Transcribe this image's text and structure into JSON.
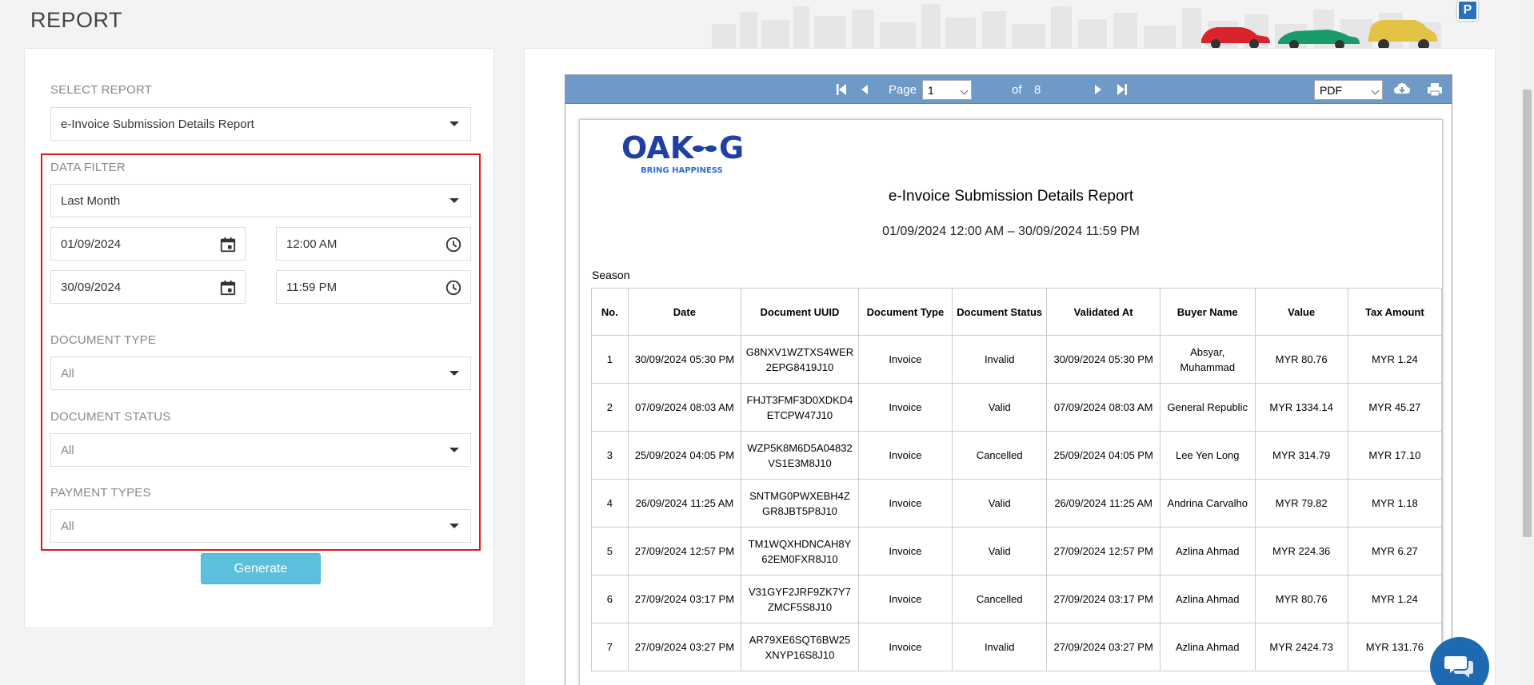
{
  "page": {
    "title": "REPORT"
  },
  "left": {
    "select_report_label": "SELECT REPORT",
    "select_report_value": "e-Invoice Submission Details Report",
    "data_filter_label": "DATA FILTER",
    "data_filter_value": "Last Month",
    "start_date": "01/09/2024",
    "start_time": "12:00 AM",
    "end_date": "30/09/2024",
    "end_time": "11:59 PM",
    "document_type_label": "DOCUMENT TYPE",
    "document_type_value": "All",
    "document_status_label": "DOCUMENT STATUS",
    "document_status_value": "All",
    "payment_types_label": "PAYMENT TYPES",
    "payment_types_value": "All",
    "generate_label": "Generate"
  },
  "viewer": {
    "page_label": "Page",
    "page_value": "1",
    "of_label": "of",
    "total_pages": "8",
    "format_value": "PDF"
  },
  "report": {
    "logo_text": "OAK G",
    "logo_tagline": "BRING HAPPINESS",
    "title": "e-Invoice Submission Details Report",
    "range": "01/09/2024 12:00 AM – 30/09/2024 11:59 PM",
    "section": "Season",
    "headers": [
      "No.",
      "Date",
      "Document UUID",
      "Document Type",
      "Document Status",
      "Validated At",
      "Buyer Name",
      "Value",
      "Tax Amount"
    ],
    "rows": [
      {
        "no": "1",
        "date": "30/09/2024 05:30 PM",
        "uuid1": "G8NXV1WZTXS4WER",
        "uuid2": "2EPG8419J10",
        "type": "Invoice",
        "status": "Invalid",
        "validated": "30/09/2024 05:30 PM",
        "buyer1": "Absyar,",
        "buyer2": "Muhammad",
        "value": "MYR 80.76",
        "tax": "MYR 1.24"
      },
      {
        "no": "2",
        "date": "07/09/2024 08:03 AM",
        "uuid1": "FHJT3FMF3D0XDKD4",
        "uuid2": "ETCPW47J10",
        "type": "Invoice",
        "status": "Valid",
        "validated": "07/09/2024 08:03 AM",
        "buyer1": "General Republic",
        "buyer2": "",
        "value": "MYR 1334.14",
        "tax": "MYR 45.27"
      },
      {
        "no": "3",
        "date": "25/09/2024 04:05 PM",
        "uuid1": "WZP5K8M6D5A04832",
        "uuid2": "VS1E3M8J10",
        "type": "Invoice",
        "status": "Cancelled",
        "validated": "25/09/2024 04:05 PM",
        "buyer1": "Lee Yen Long",
        "buyer2": "",
        "value": "MYR 314.79",
        "tax": "MYR 17.10"
      },
      {
        "no": "4",
        "date": "26/09/2024 11:25 AM",
        "uuid1": "SNTMG0PWXEBH4Z",
        "uuid2": "GR8JBT5P8J10",
        "type": "Invoice",
        "status": "Valid",
        "validated": "26/09/2024 11:25 AM",
        "buyer1": "Andrina Carvalho",
        "buyer2": "",
        "value": "MYR 79.82",
        "tax": "MYR 1.18"
      },
      {
        "no": "5",
        "date": "27/09/2024 12:57 PM",
        "uuid1": "TM1WQXHDNCAH8Y",
        "uuid2": "62EM0FXR8J10",
        "type": "Invoice",
        "status": "Valid",
        "validated": "27/09/2024 12:57 PM",
        "buyer1": "Azlina Ahmad",
        "buyer2": "",
        "value": "MYR 224.36",
        "tax": "MYR 6.27"
      },
      {
        "no": "6",
        "date": "27/09/2024 03:17 PM",
        "uuid1": "V31GYF2JRF9ZK7Y7",
        "uuid2": "ZMCF5S8J10",
        "type": "Invoice",
        "status": "Cancelled",
        "validated": "27/09/2024 03:17 PM",
        "buyer1": "Azlina Ahmad",
        "buyer2": "",
        "value": "MYR 80.76",
        "tax": "MYR 1.24"
      },
      {
        "no": "7",
        "date": "27/09/2024 03:27 PM",
        "uuid1": "AR79XE6SQT6BW25",
        "uuid2": "XNYP16S8J10",
        "type": "Invoice",
        "status": "Invalid",
        "validated": "27/09/2024 03:27 PM",
        "buyer1": "Azlina Ahmad",
        "buyer2": "",
        "value": "MYR 2424.73",
        "tax": "MYR 131.76"
      }
    ]
  },
  "colors": {
    "accent": "#5bc0de",
    "toolbar": "#6f99c6",
    "highlight": "#e0161b",
    "chat": "#1d6ab3"
  }
}
